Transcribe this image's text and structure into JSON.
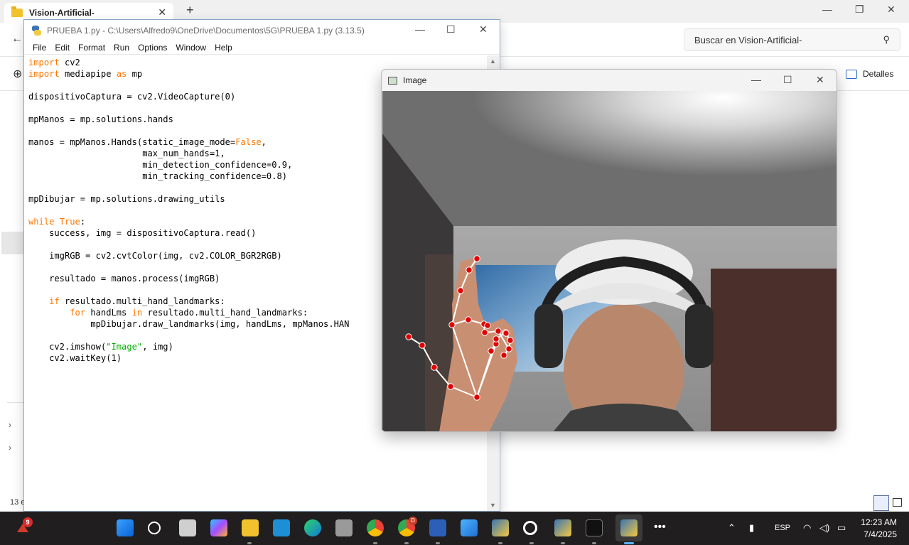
{
  "explorer": {
    "tab_title": "Vision-Artificial-",
    "search_placeholder": "Buscar en Vision-Artificial-",
    "details_label": "Detalles",
    "status_text": "13 e"
  },
  "idle": {
    "title": "PRUEBA 1.py - C:\\Users\\Alfredo9\\OneDrive\\Documentos\\5G\\PRUEBA 1.py (3.13.5)",
    "menu": [
      "File",
      "Edit",
      "Format",
      "Run",
      "Options",
      "Window",
      "Help"
    ],
    "code_lines": [
      "import cv2",
      "import mediapipe as mp",
      "",
      "dispositivoCaptura = cv2.VideoCapture(0)",
      "",
      "mpManos = mp.solutions.hands",
      "",
      "manos = mpManos.Hands(static_image_mode=False,",
      "                      max_num_hands=1,",
      "                      min_detection_confidence=0.9,",
      "                      min_tracking_confidence=0.8)",
      "",
      "mpDibujar = mp.solutions.drawing_utils",
      "",
      "while True:",
      "    success, img = dispositivoCaptura.read()",
      "",
      "    imgRGB = cv2.cvtColor(img, cv2.COLOR_BGR2RGB)",
      "",
      "    resultado = manos.process(imgRGB)",
      "",
      "    if resultado.multi_hand_landmarks:",
      "        for handLms in resultado.multi_hand_landmarks:",
      "            mpDibujar.draw_landmarks(img, handLms, mpManos.HAN",
      "",
      "    cv2.imshow(\"Image\", img)",
      "    cv2.waitKey(1)"
    ]
  },
  "image_window": {
    "title": "Image"
  },
  "taskbar": {
    "weather_badge": "9",
    "chrome_badge": "D",
    "language": "ESP",
    "time": "12:23 AM",
    "date": "7/4/2025"
  },
  "colors": {
    "keyword": "#ff7700",
    "string": "#00aa00",
    "landmark": "#e00000",
    "connection": "#ffffff",
    "taskbar": "#201e1f"
  }
}
